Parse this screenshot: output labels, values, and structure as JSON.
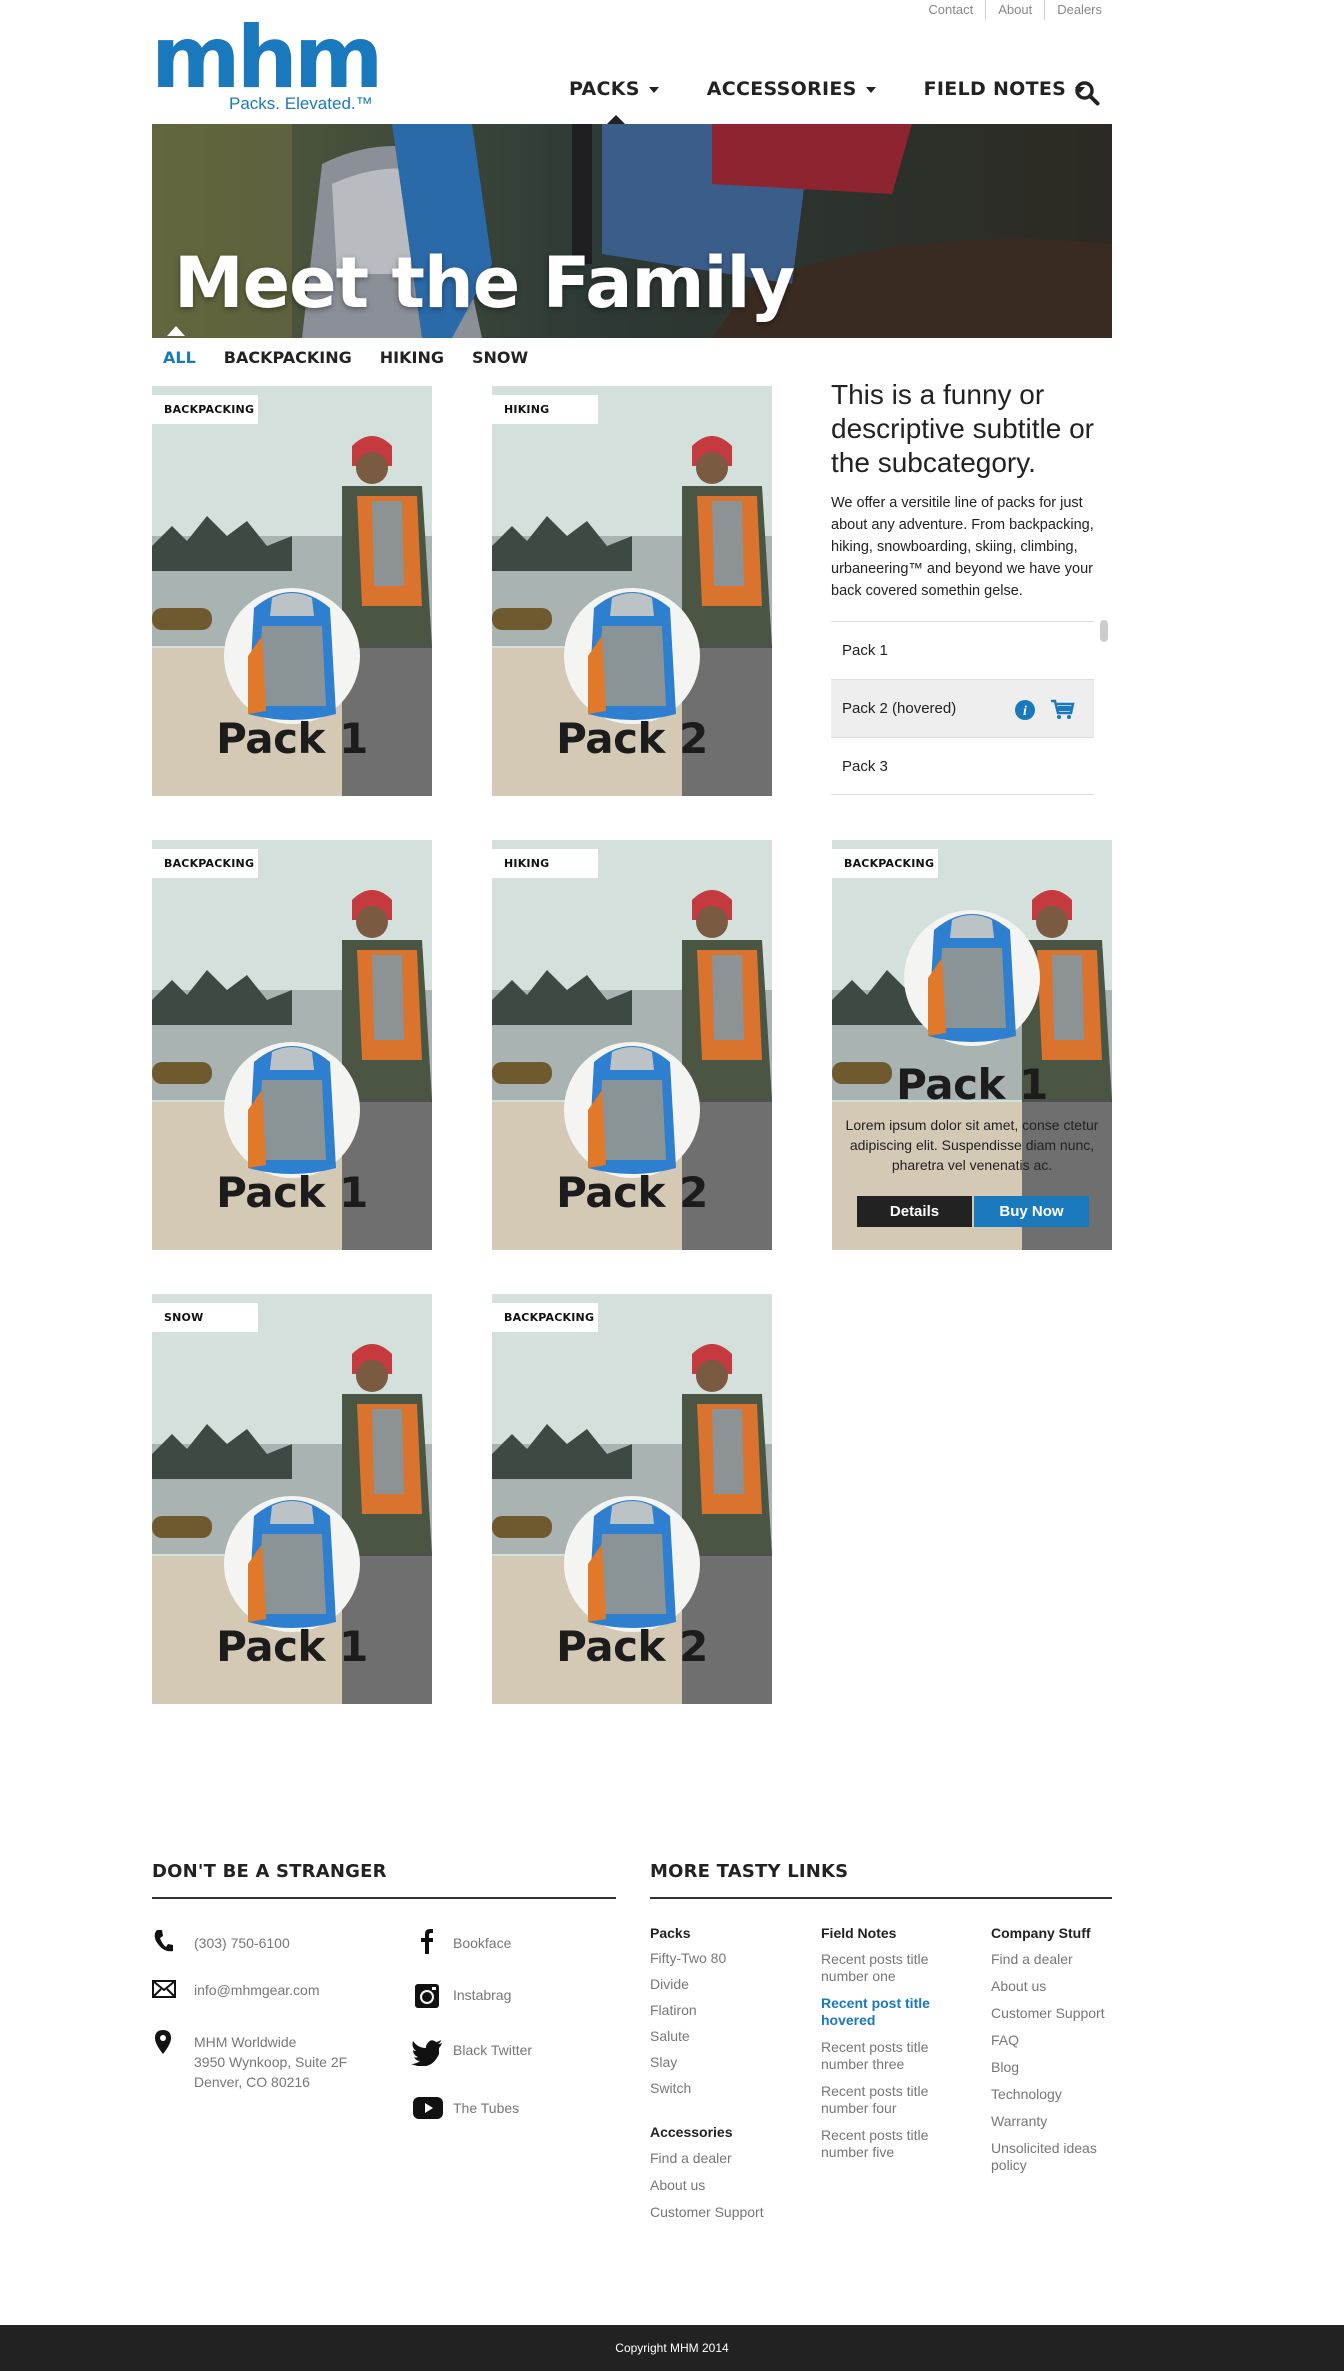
{
  "utility_nav": [
    "Contact",
    "About",
    "Dealers"
  ],
  "logo": {
    "word": "mhm",
    "tagline": "Packs. Elevated.™"
  },
  "nav": {
    "items": [
      "PACKS",
      "ACCESSORIES",
      "FIELD NOTES"
    ],
    "search_icon": "search-icon"
  },
  "hero": {
    "title": "Meet the Family"
  },
  "filters": [
    "ALL",
    "BACKPACKING",
    "HIKING",
    "SNOW"
  ],
  "cards": [
    {
      "badge": "BACKPACKING",
      "name": "Pack 1"
    },
    {
      "badge": "HIKING",
      "name": "Pack 2"
    },
    {
      "badge": "BACKPACKING",
      "name": "Pack 1"
    },
    {
      "badge": "HIKING",
      "name": "Pack 2"
    },
    {
      "badge": "BACKPACKING",
      "name": "Pack 1",
      "desc": "Lorem ipsum dolor sit amet, conse ctetur adipiscing elit. Suspendisse diam nunc, pharetra vel venenatis ac.",
      "details": "Details",
      "buy": "Buy Now"
    },
    {
      "badge": "SNOW",
      "name": "Pack 1"
    },
    {
      "badge": "BACKPACKING",
      "name": "Pack 2"
    }
  ],
  "side": {
    "title": "This is a funny or descriptive subtitle or the subcategory.",
    "text": "We offer a versitile line of packs for just about any adventure. From backpacking, hiking, snowboarding, skiing, climbing, urbaneering™ and beyond we have your back covered somethin gelse.",
    "list": [
      "Pack 1",
      "Pack 2 (hovered)",
      "Pack 3"
    ]
  },
  "footer": {
    "left_heading": "DON'T BE A STRANGER",
    "phone": "(303) 750-6100",
    "email": "info@mhmgear.com",
    "address": [
      "MHM Worldwide",
      "3950 Wynkoop, Suite 2F",
      "Denver, CO 80216"
    ],
    "social": [
      "Bookface",
      "Instabrag",
      "Black Twitter",
      "The Tubes"
    ],
    "right_heading": "MORE TASTY LINKS",
    "packs": {
      "heading": "Packs",
      "links": [
        "Fifty-Two 80",
        "Divide",
        "Flatiron",
        "Salute",
        "Slay",
        "Switch"
      ]
    },
    "accessories": {
      "heading": "Accessories",
      "links": [
        "Find a dealer",
        "About us",
        "Customer Support"
      ]
    },
    "field_notes": {
      "heading": "Field Notes",
      "links": [
        "Recent posts title number one",
        "Recent post title hovered",
        "Recent posts title number three",
        "Recent posts title number four",
        "Recent posts title number five"
      ]
    },
    "company": {
      "heading": "Company Stuff",
      "links": [
        "Find a dealer",
        "About us",
        "Customer Support",
        "FAQ",
        "Blog",
        "Technology",
        "Warranty",
        "Unsolicited ideas policy"
      ]
    },
    "copyright": "Copyright MHM 2014"
  },
  "colors": {
    "brand_blue": "#1a78bd",
    "dark": "#222222"
  }
}
